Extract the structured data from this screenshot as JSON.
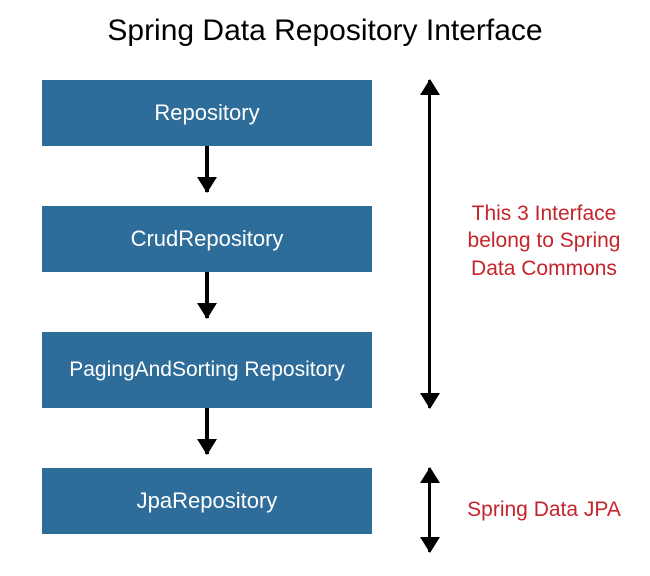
{
  "title": "Spring Data Repository Interface",
  "boxes": {
    "b1": "Repository",
    "b2": "CrudRepository",
    "b3": "PagingAndSorting Repository",
    "b4": "JpaRepository"
  },
  "annotations": {
    "commons": "This 3 Interface belong to Spring Data Commons",
    "jpa": "Spring Data JPA"
  },
  "colors": {
    "box_bg": "#2E6C99",
    "box_text": "#FFFFFF",
    "annot_text": "#C6242B",
    "arrow": "#000000"
  }
}
